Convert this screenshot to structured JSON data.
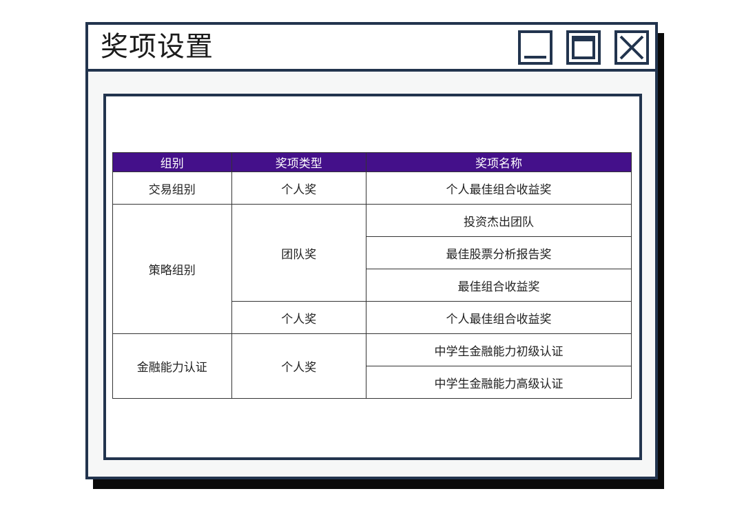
{
  "window": {
    "title": "奖项设置",
    "controls": [
      "minimize-icon",
      "maximize-icon",
      "close-icon"
    ]
  },
  "colors": {
    "frame": "#22344e",
    "header_bg": "#44108a",
    "header_text": "#ffffff",
    "shadow": "#0a0a0a"
  },
  "table": {
    "headers": [
      "组别",
      "奖项类型",
      "奖项名称"
    ],
    "groups": [
      {
        "group": "交易组别",
        "types": [
          {
            "type": "个人奖",
            "awards": [
              "个人最佳组合收益奖"
            ]
          }
        ]
      },
      {
        "group": "策略组别",
        "types": [
          {
            "type": "团队奖",
            "awards": [
              "投资杰出团队",
              "最佳股票分析报告奖",
              "最佳组合收益奖"
            ]
          },
          {
            "type": "个人奖",
            "awards": [
              "个人最佳组合收益奖"
            ]
          }
        ]
      },
      {
        "group": "金融能力认证",
        "types": [
          {
            "type": "个人奖",
            "awards": [
              "中学生金融能力初级认证",
              "中学生金融能力高级认证"
            ]
          }
        ]
      }
    ]
  }
}
